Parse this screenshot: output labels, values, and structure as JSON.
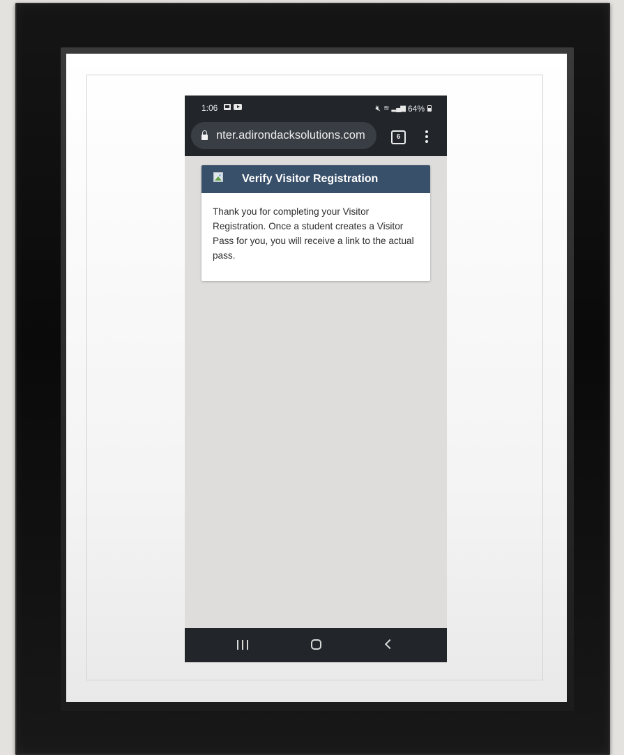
{
  "status_bar": {
    "time": "1:06",
    "battery": "64%",
    "icons": [
      "gallery-notification-icon",
      "youtube-notification-icon",
      "mute-icon",
      "wifi-icon",
      "signal-icon",
      "battery-icon"
    ]
  },
  "browser": {
    "url": "nter.adirondacksolutions.com",
    "tab_count": "6",
    "icons": [
      "lock-icon",
      "tabs-icon",
      "more-menu-icon"
    ]
  },
  "card": {
    "title": "Verify Visitor Registration",
    "body": "Thank you for completing your Visitor Registration. Once a student creates a Visitor Pass for you, you will receive a link to the actual pass.",
    "logo_icon": "broken-image-icon"
  },
  "navigation": {
    "icons": [
      "recent-apps-icon",
      "home-icon",
      "back-icon"
    ]
  },
  "colors": {
    "browser_chrome": "#22262b",
    "url_bar": "#393e44",
    "card_header": "#39506a",
    "page_background": "#dedddb",
    "frame": "#111111",
    "mat": "#ffffff"
  }
}
